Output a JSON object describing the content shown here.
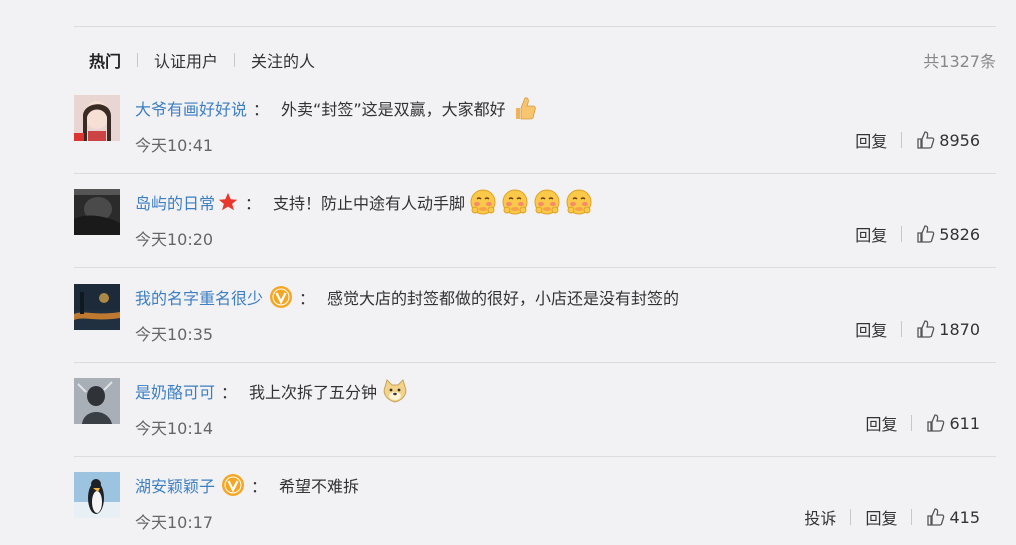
{
  "header": {
    "tabs": [
      "热门",
      "认证用户",
      "关注的人"
    ],
    "total": "共1327条"
  },
  "comments": [
    {
      "username": "大爷有画好好说",
      "colon": "：",
      "text": "外卖“封签”这是双赢，大家都好",
      "emoji": [
        "thumbs-up-icon"
      ],
      "time": "今天10:41",
      "reply": "回复",
      "likes": "8956"
    },
    {
      "username": "岛屿的日常",
      "colon": "：",
      "text": "支持！防止中途有人动手脚",
      "emoji": [
        "shy-face-icon",
        "shy-face-icon",
        "shy-face-icon",
        "shy-face-icon"
      ],
      "time": "今天10:20",
      "reply": "回复",
      "likes": "5826"
    },
    {
      "username": "我的名字重名很少",
      "colon": "：",
      "text": "感觉大店的封签都做的很好，小店还是没有封签的",
      "time": "今天10:35",
      "reply": "回复",
      "likes": "1870"
    },
    {
      "username": "是奶酪可可",
      "colon": "：",
      "text": "我上次拆了五分钟",
      "emoji": [
        "doge-icon"
      ],
      "time": "今天10:14",
      "reply": "回复",
      "likes": "611"
    },
    {
      "username": "湖安颖颖子",
      "colon": "：",
      "text": "希望不难拆",
      "time": "今天10:17",
      "report": "投诉",
      "reply": "回复",
      "likes": "415"
    }
  ],
  "colors": {
    "username": "#3d7fc1",
    "background": "#f2f2f5",
    "badge": "#f5a623"
  }
}
